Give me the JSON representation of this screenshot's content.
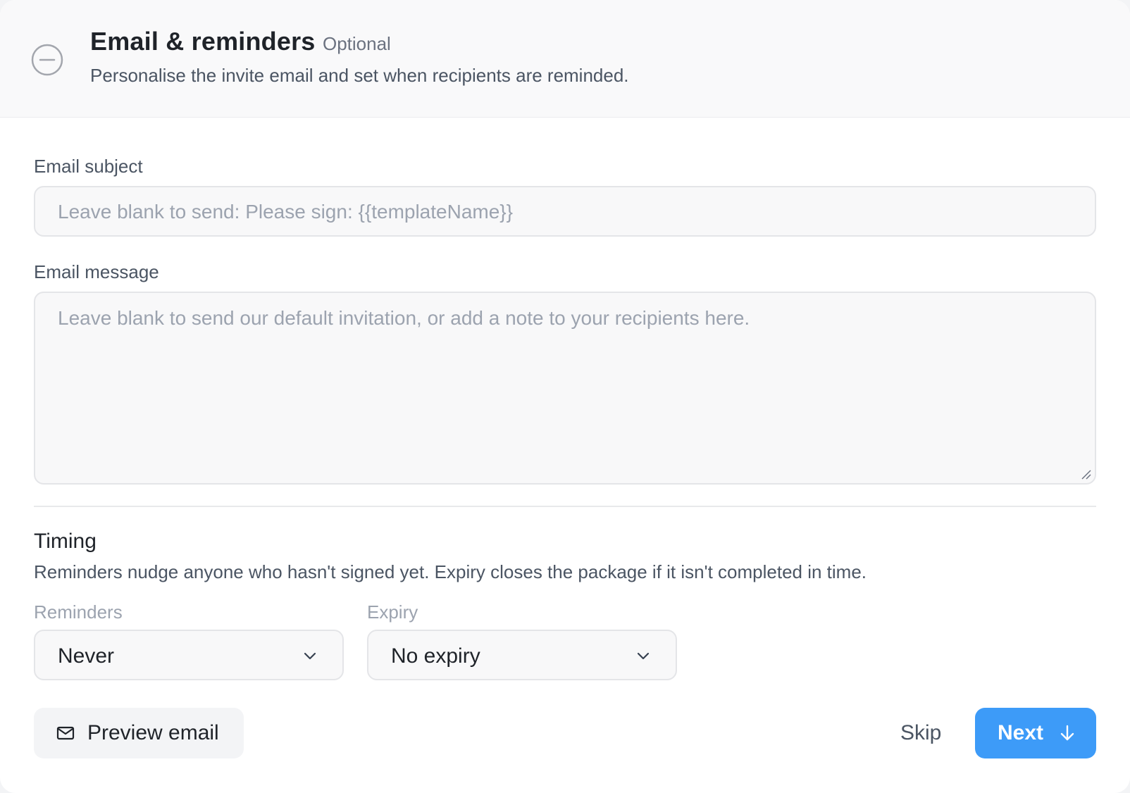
{
  "header": {
    "title": "Email & reminders",
    "optional_tag": "Optional",
    "subtitle": "Personalise the invite email and set when recipients are reminded.",
    "status_icon": "minus-circle-icon"
  },
  "email_subject": {
    "label": "Email subject",
    "value": "",
    "placeholder": "Leave blank to send: Please sign: {{templateName}}"
  },
  "email_message": {
    "label": "Email message",
    "value": "",
    "placeholder": "Leave blank to send our default invitation, or add a note to your recipients here."
  },
  "timing": {
    "title": "Timing",
    "description": "Reminders nudge anyone who hasn't signed yet. Expiry closes the package if it isn't completed in time.",
    "reminders": {
      "label": "Reminders",
      "selected": "Never",
      "icon": "chevron-down-icon"
    },
    "expiry": {
      "label": "Expiry",
      "selected": "No expiry",
      "icon": "chevron-down-icon"
    }
  },
  "actions": {
    "preview_label": "Preview email",
    "preview_icon": "mail-icon",
    "skip_label": "Skip",
    "next_label": "Next",
    "next_icon": "arrow-down-icon"
  },
  "colors": {
    "primary": "#3d9bf8",
    "header_bg": "#f9f9fa",
    "field_bg": "#f8f8f9",
    "muted_text": "#9ca3af"
  }
}
